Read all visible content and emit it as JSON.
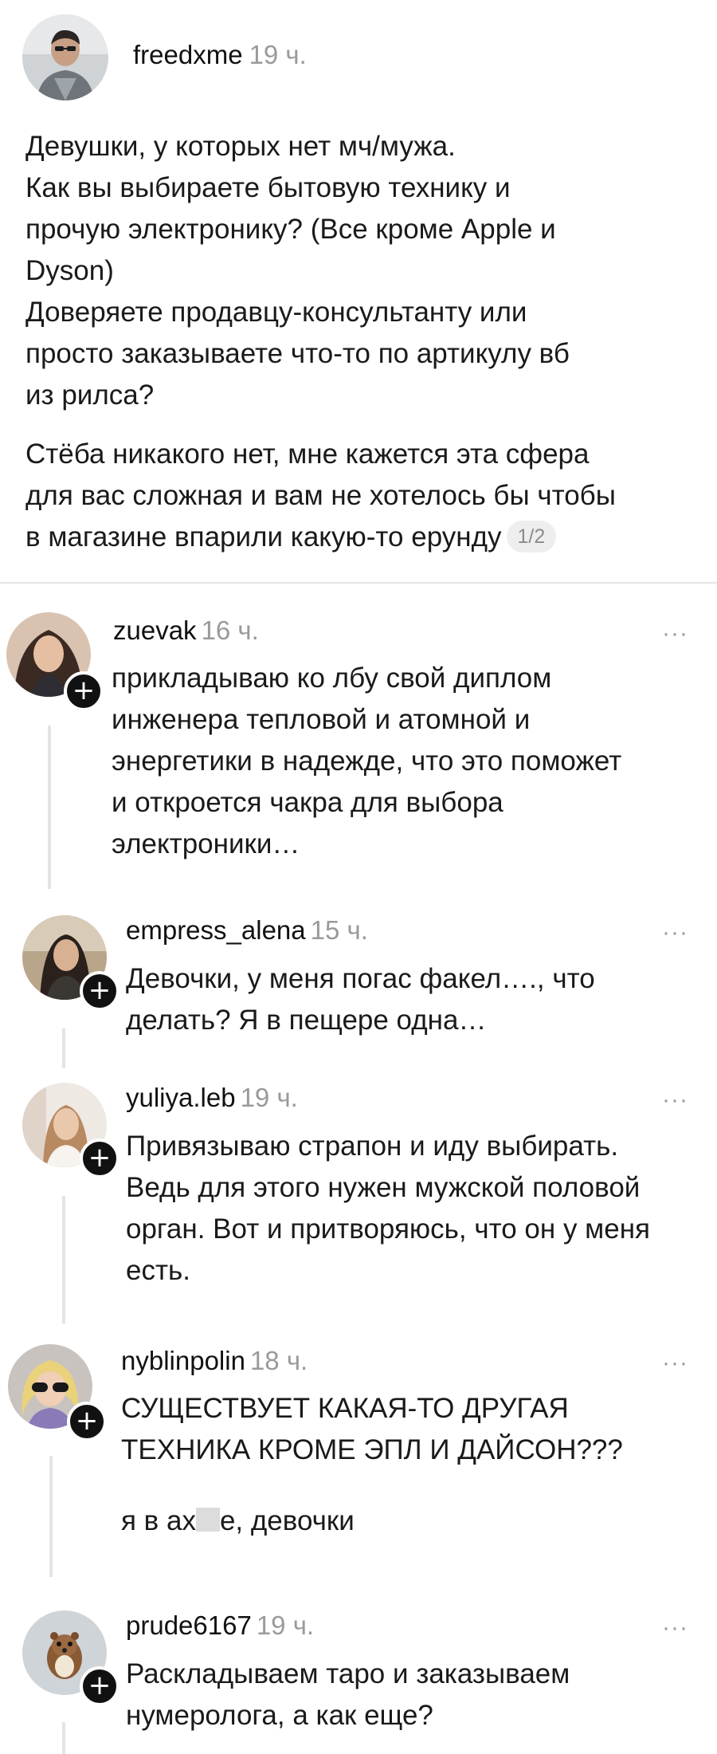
{
  "post": {
    "username": "freedxme",
    "time": "19 ч.",
    "paragraph1": [
      "Девушки, у которых нет мч/мужа.",
      "Как вы выбираете бытовую технику и",
      "прочую электронику? (Все кроме Apple и",
      "Dyson)",
      "Доверяете продавцу-консультанту или",
      "просто заказываете что-то по артикулу вб",
      "из рилса?"
    ],
    "paragraph2": [
      "Стёба никакого нет, мне кажется эта сфера",
      "для вас сложная и вам не хотелось бы чтобы",
      "в магазине впарили какую-то ерунду"
    ],
    "page_badge": "1/2"
  },
  "comments": [
    {
      "username": "zuevak",
      "time": "16 ч.",
      "lines": [
        "прикладываю ко лбу свой диплом",
        "инженера тепловой и атомной и",
        "энергетики в надежде, что это поможет",
        "и откроется чакра для выбора",
        "электроники…"
      ]
    },
    {
      "username": "empress_alena",
      "time": "15 ч.",
      "lines": [
        "Девочки, у меня погас факел…., что",
        "делать? Я в пещере одна…"
      ]
    },
    {
      "username": "yuliya.leb",
      "time": "19 ч.",
      "lines": [
        "Привязываю страпон и иду выбирать.",
        "Ведь для этого нужен мужской половой",
        "орган. Вот и притворяюсь, что он у меня",
        "есть."
      ]
    },
    {
      "username": "nyblinpolin",
      "time": "18 ч.",
      "lines": [
        "СУЩЕСТВУЕТ КАКАЯ-ТО ДРУГАЯ",
        "ТЕХНИКА КРОМЕ ЭПЛ И ДАЙСОН???"
      ],
      "extra_before": "я в ах",
      "extra_after": "е, девочки"
    },
    {
      "username": "prude6167",
      "time": "19 ч.",
      "lines": [
        "Раскладываем таро и заказываем",
        "нумеролога, а как еще?"
      ]
    }
  ],
  "ui": {
    "more_label": "···",
    "follow_label": "+"
  }
}
